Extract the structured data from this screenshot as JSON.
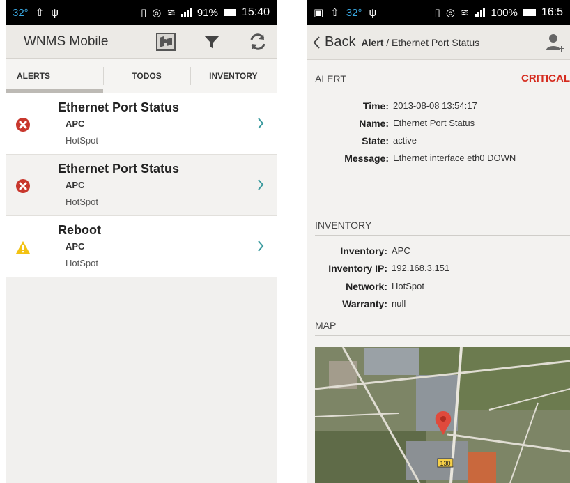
{
  "left": {
    "statusbar": {
      "temp": "32°",
      "battery": "91%",
      "time": "15:40"
    },
    "app_title": "WNMS Mobile",
    "tabs": [
      {
        "label": "ALERTS",
        "active": true
      },
      {
        "label": "TODOS",
        "active": false
      },
      {
        "label": "INVENTORY",
        "active": false
      }
    ],
    "alerts": [
      {
        "title": "Ethernet Port Status",
        "device": "APC",
        "network": "HotSpot",
        "severity": "error",
        "icon": "error-icon"
      },
      {
        "title": "Ethernet Port Status",
        "device": "APC",
        "network": "HotSpot",
        "severity": "error",
        "icon": "error-icon"
      },
      {
        "title": "Reboot",
        "device": "APC",
        "network": "HotSpot",
        "severity": "warning",
        "icon": "warning-icon"
      }
    ]
  },
  "right": {
    "statusbar": {
      "temp": "32°",
      "battery": "100%",
      "time": "16:5"
    },
    "back_label": "Back",
    "breadcrumb": {
      "current": "Alert",
      "separator": " / ",
      "sub": "Ethernet Port Status"
    },
    "alert_section": {
      "heading": "ALERT",
      "severity": "CRITICAL",
      "fields": [
        {
          "key": "Time:",
          "value": "2013-08-08 13:54:17"
        },
        {
          "key": "Name:",
          "value": "Ethernet Port Status"
        },
        {
          "key": "State:",
          "value": "active"
        },
        {
          "key": "Message:",
          "value": "Ethernet interface eth0 DOWN"
        }
      ]
    },
    "inventory_section": {
      "heading": "INVENTORY",
      "fields": [
        {
          "key": "Inventory:",
          "value": "APC"
        },
        {
          "key": "Inventory IP:",
          "value": "192.168.3.151"
        },
        {
          "key": "Network:",
          "value": "HotSpot"
        },
        {
          "key": "Warranty:",
          "value": "null"
        }
      ]
    },
    "map_section": {
      "heading": "MAP",
      "road_label": "130"
    }
  },
  "colors": {
    "critical": "#d52b1e",
    "error": "#c8372d",
    "warning": "#f3c211",
    "chevron": "#3a9a9e",
    "statusbar_blue": "#3aa7e0"
  }
}
